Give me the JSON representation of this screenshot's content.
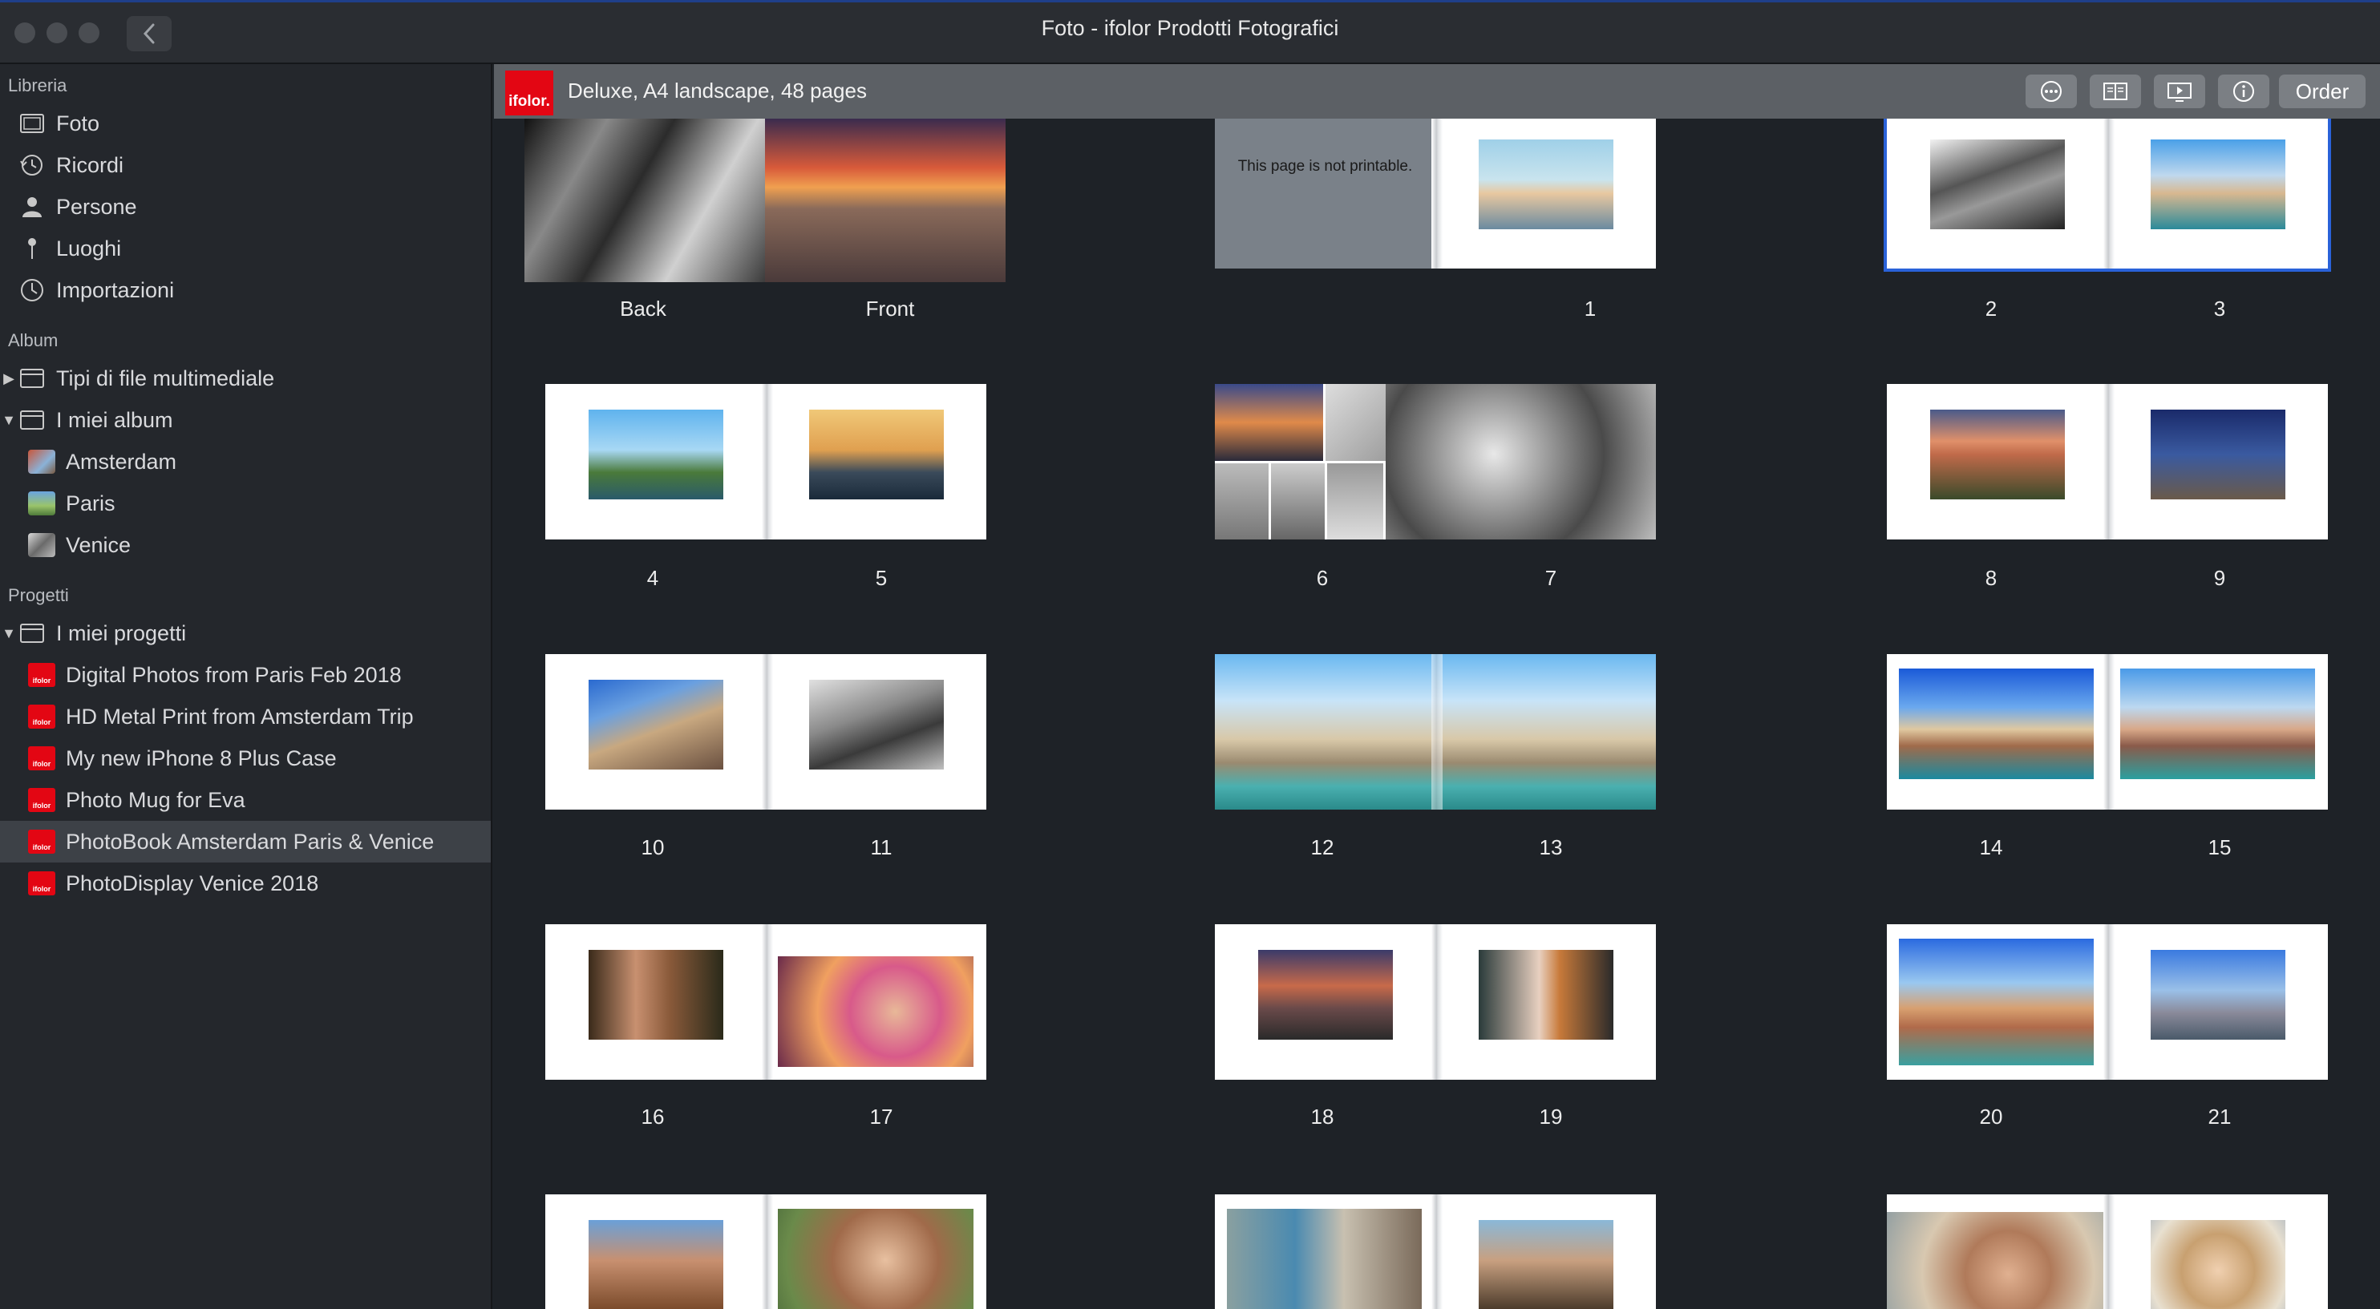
{
  "window": {
    "title": "Foto - ifolor Prodotti Fotografici"
  },
  "sidebar": {
    "libreria_title": "Libreria",
    "libreria": [
      {
        "label": "Foto",
        "icon": "photos-icon"
      },
      {
        "label": "Ricordi",
        "icon": "memories-icon"
      },
      {
        "label": "Persone",
        "icon": "people-icon"
      },
      {
        "label": "Luoghi",
        "icon": "places-icon"
      },
      {
        "label": "Importazioni",
        "icon": "imports-icon"
      }
    ],
    "album_title": "Album",
    "album": [
      {
        "label": "Tipi di file multimediale",
        "disclosure": "▶"
      },
      {
        "label": "I miei album",
        "disclosure": "▼"
      },
      {
        "label": "Amsterdam"
      },
      {
        "label": "Paris"
      },
      {
        "label": "Venice"
      }
    ],
    "progetti_title": "Progetti",
    "progetti": [
      {
        "label": "I miei progetti",
        "disclosure": "▼"
      },
      {
        "label": "Digital Photos from Paris Feb 2018"
      },
      {
        "label": "HD Metal Print from Amsterdam Trip"
      },
      {
        "label": "My new iPhone 8 Plus Case"
      },
      {
        "label": "Photo Mug for Eva"
      },
      {
        "label": "PhotoBook Amsterdam Paris & Venice",
        "selected": true
      },
      {
        "label": "PhotoDisplay Venice 2018"
      }
    ]
  },
  "toolbar": {
    "logo": "ifolor.",
    "title": "Deluxe, A4 landscape, 48 pages",
    "order": "Order"
  },
  "pages": {
    "not_printable": "This page is not printable.",
    "cover_back": "Back",
    "cover_front": "Front",
    "labels": [
      "1",
      "2",
      "3",
      "4",
      "5",
      "6",
      "7",
      "8",
      "9",
      "10",
      "11",
      "12",
      "13",
      "14",
      "15",
      "16",
      "17",
      "18",
      "19",
      "20",
      "21"
    ]
  },
  "colors": {
    "accent": "#2a62d9",
    "brand": "#e30613"
  }
}
